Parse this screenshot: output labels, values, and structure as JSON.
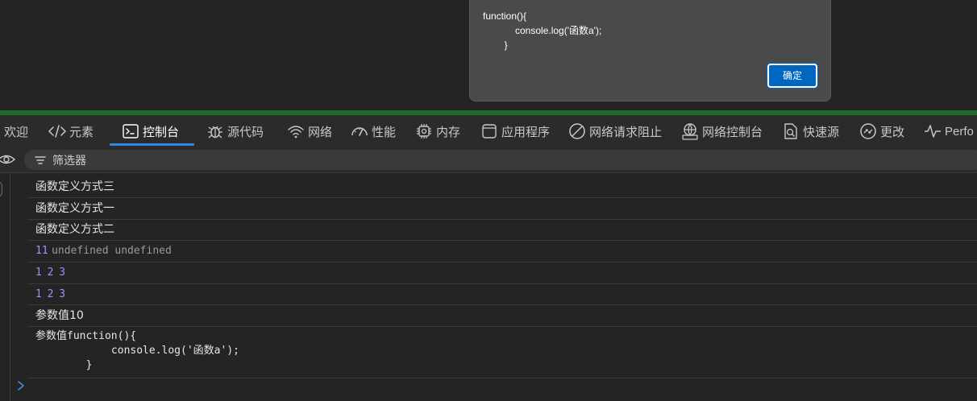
{
  "dialog": {
    "message": "function(){\n            console.log('函数a');\n        }",
    "ok_label": "确定"
  },
  "tabs": [
    {
      "label": "欢迎",
      "icon": "none"
    },
    {
      "label": "元素",
      "icon": "code-icon"
    },
    {
      "label": "控制台",
      "icon": "console-icon",
      "active": true
    },
    {
      "label": "源代码",
      "icon": "bug-icon"
    },
    {
      "label": "网络",
      "icon": "wifi-icon"
    },
    {
      "label": "性能",
      "icon": "gauge-icon"
    },
    {
      "label": "内存",
      "icon": "chip-icon"
    },
    {
      "label": "应用程序",
      "icon": "app-icon"
    },
    {
      "label": "网络请求阻止",
      "icon": "block-icon"
    },
    {
      "label": "网络控制台",
      "icon": "network-console-icon"
    },
    {
      "label": "快速源",
      "icon": "quick-source-icon"
    },
    {
      "label": "更改",
      "icon": "changes-icon"
    },
    {
      "label": "Perfo",
      "icon": "pulse-icon"
    }
  ],
  "filter": {
    "placeholder": "筛选器"
  },
  "console": {
    "messages": [
      {
        "text": "函数定义方式三"
      },
      {
        "text": "函数定义方式一"
      },
      {
        "text": "函数定义方式二"
      },
      {
        "num": "11",
        "rest": "undefined undefined"
      },
      {
        "num": "1 2 3"
      },
      {
        "num": "1 2 3"
      },
      {
        "text": "参数值10"
      },
      {
        "text": "参数值function(){\n            console.log('函数a');\n        }"
      }
    ]
  },
  "colors": {
    "accent": "#2e8ae6",
    "dock_border": "#1e6b2e",
    "number": "#9c91ff",
    "dialog_button": "#0067c0"
  }
}
